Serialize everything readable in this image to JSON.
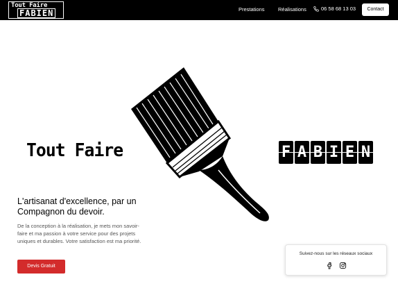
{
  "header": {
    "logo": {
      "line1": "Tout Faire",
      "line2": "FABIEN"
    },
    "nav": {
      "prestations": "Prestations",
      "realisations": "Réalisations"
    },
    "phone": "06 58 68 13 03",
    "contact_label": "Contact"
  },
  "hero": {
    "brand_left": "Tout Faire",
    "brand_right_letters": [
      "F",
      "A",
      "B",
      "I",
      "E",
      "N"
    ],
    "brush_icon": "paintbrush-illustration"
  },
  "intro": {
    "headline": "L'artisanat d'excellence, par un Compagnon du devoir.",
    "description": "De la conception à la réalisation, je mets mon savoir-faire et ma passion à votre service pour des projets uniques et durables. Votre satisfaction est ma priorité.",
    "cta_label": "Devis Gratuit"
  },
  "social": {
    "title": "Suivez-nous sur les réseaux sociaux",
    "icons": [
      "facebook-icon",
      "instagram-icon"
    ]
  },
  "colors": {
    "header_bg": "#000000",
    "cta_bg": "#d32b2b"
  }
}
